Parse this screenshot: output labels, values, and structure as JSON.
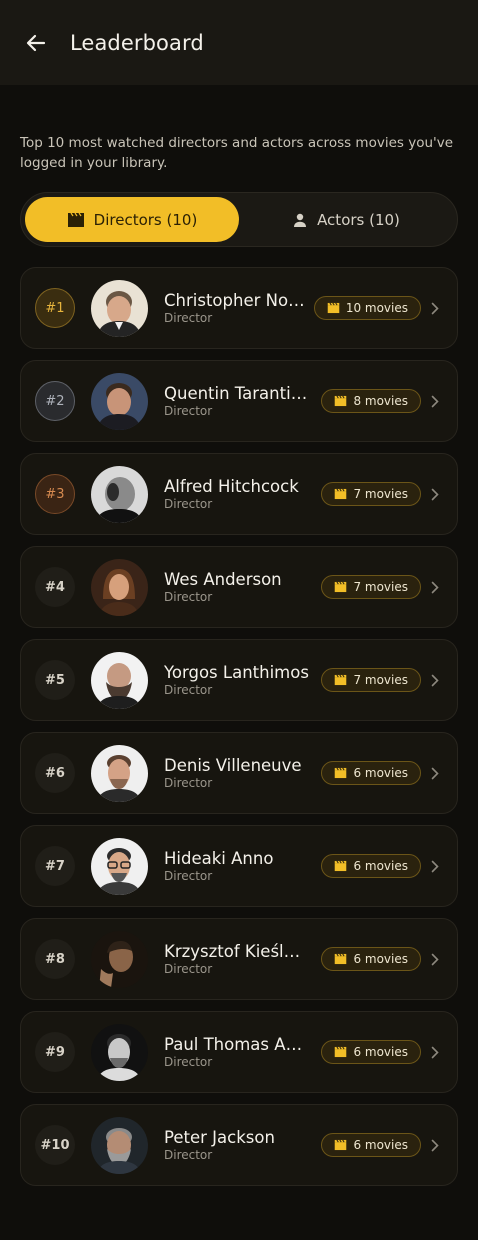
{
  "header": {
    "title": "Leaderboard",
    "back_icon": "arrow-left-icon"
  },
  "intro": "Top 10 most watched directors and actors across movies you've logged in your library.",
  "tabs": [
    {
      "label": "Directors (10)",
      "icon": "clapperboard-icon",
      "active": true
    },
    {
      "label": "Actors (10)",
      "icon": "person-icon",
      "active": false
    }
  ],
  "colors": {
    "accent": "#f2be27",
    "gold": "#e6b43c",
    "silver": "#aeb2ba",
    "bronze": "#d68a50"
  },
  "directors": [
    {
      "rank": "#1",
      "name": "Christopher Nolan",
      "role": "Director",
      "count": "10 movies"
    },
    {
      "rank": "#2",
      "name": "Quentin Tarantino",
      "role": "Director",
      "count": "8 movies"
    },
    {
      "rank": "#3",
      "name": "Alfred Hitchcock",
      "role": "Director",
      "count": "7 movies"
    },
    {
      "rank": "#4",
      "name": "Wes Anderson",
      "role": "Director",
      "count": "7 movies"
    },
    {
      "rank": "#5",
      "name": "Yorgos Lanthimos",
      "role": "Director",
      "count": "7 movies"
    },
    {
      "rank": "#6",
      "name": "Denis Villeneuve",
      "role": "Director",
      "count": "6 movies"
    },
    {
      "rank": "#7",
      "name": "Hideaki Anno",
      "role": "Director",
      "count": "6 movies"
    },
    {
      "rank": "#8",
      "name": "Krzysztof Kieślow...",
      "role": "Director",
      "count": "6 movies"
    },
    {
      "rank": "#9",
      "name": "Paul Thomas And...",
      "role": "Director",
      "count": "6 movies"
    },
    {
      "rank": "#10",
      "name": "Peter Jackson",
      "role": "Director",
      "count": "6 movies"
    }
  ]
}
